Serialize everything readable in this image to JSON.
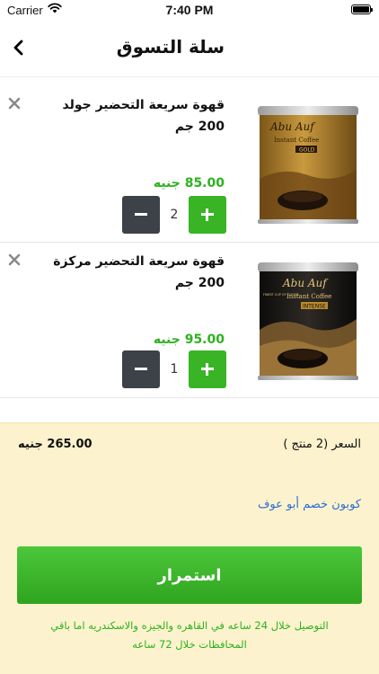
{
  "status_bar": {
    "carrier": "Carrier",
    "time": "7:40 PM"
  },
  "header": {
    "title": "سلة التسوق"
  },
  "cart": {
    "items": [
      {
        "name": "قهوة سريعة التحضير جولد 200 جم",
        "price": "85.00 جنيه",
        "quantity": "2",
        "image": {
          "brand": "Abu Auf",
          "subtitle": "Instant Coffee",
          "variant": "GOLD",
          "color": "#a5772a"
        }
      },
      {
        "name": "قهوة سريعة التحضير مركزة 200 جم",
        "price": "95.00 جنيه",
        "quantity": "1",
        "image": {
          "brand": "Abu Auf",
          "subtitle": "Instant Coffee",
          "variant": "INTENSE",
          "note": "FINEST CUP OF COFFEE",
          "color": "#1c1a18"
        }
      }
    ]
  },
  "summary": {
    "price_label": "السعر (2 منتج )",
    "total": "265.00 جنيه",
    "coupon_link": "كوبون خصم أبو عوف",
    "continue_label": "استمرار",
    "delivery_note": "التوصيل خلال 24 ساعه في القاهره والجيزه والاسكندريه اما باقي المحافظات خلال 72 ساعه"
  },
  "colors": {
    "accent_green": "#38b425",
    "price_green": "#2db21f",
    "summary_bg": "#fcf2cd",
    "link_blue": "#2a6ed0",
    "minus_dark": "#3d4148"
  },
  "icons": {
    "back": "chevron-left-icon",
    "remove": "close-icon",
    "minus": "minus-icon",
    "plus": "plus-icon",
    "wifi": "wifi-icon",
    "battery": "battery-icon"
  }
}
